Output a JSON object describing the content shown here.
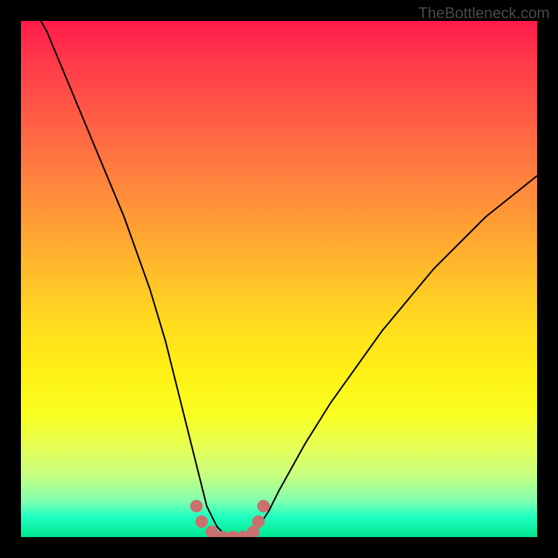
{
  "watermark": "TheBottleneck.com",
  "chart_data": {
    "type": "line",
    "title": "",
    "xlabel": "",
    "ylabel": "",
    "xlim": [
      0,
      100
    ],
    "ylim": [
      0,
      100
    ],
    "series": [
      {
        "name": "bottleneck-curve",
        "x": [
          0,
          5,
          10,
          15,
          20,
          25,
          28,
          30,
          32,
          34,
          36,
          38,
          40,
          42,
          44,
          46,
          48,
          50,
          55,
          60,
          65,
          70,
          75,
          80,
          85,
          90,
          95,
          100
        ],
        "values": [
          110,
          98,
          86,
          74,
          62,
          48,
          38,
          30,
          22,
          14,
          6,
          2,
          0,
          0,
          0,
          2,
          5,
          9,
          18,
          26,
          33,
          40,
          46,
          52,
          57,
          62,
          66,
          70
        ]
      }
    ],
    "markers": {
      "name": "highlight-dots",
      "color": "#cc6f6f",
      "points": [
        {
          "x": 34,
          "y": 6
        },
        {
          "x": 35,
          "y": 3
        },
        {
          "x": 37,
          "y": 1
        },
        {
          "x": 39,
          "y": 0
        },
        {
          "x": 41,
          "y": 0
        },
        {
          "x": 43,
          "y": 0
        },
        {
          "x": 45,
          "y": 1
        },
        {
          "x": 46,
          "y": 3
        },
        {
          "x": 47,
          "y": 6
        }
      ]
    }
  }
}
